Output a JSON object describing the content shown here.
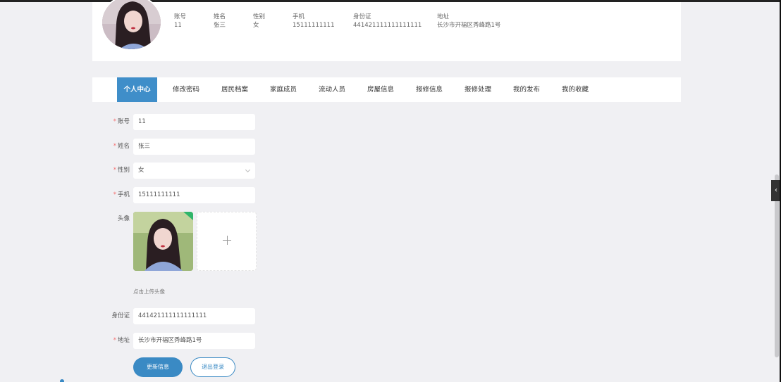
{
  "profile": {
    "fields": [
      {
        "label": "账号",
        "value": "11"
      },
      {
        "label": "姓名",
        "value": "张三"
      },
      {
        "label": "性别",
        "value": "女"
      },
      {
        "label": "手机",
        "value": "15111111111"
      },
      {
        "label": "身份证",
        "value": "441421111111111111"
      },
      {
        "label": "地址",
        "value": "长沙市开福区秀峰路1号"
      }
    ]
  },
  "nav": {
    "items": [
      "个人中心",
      "修改密码",
      "居民档案",
      "家庭成员",
      "流动人员",
      "房屋信息",
      "报修信息",
      "报修处理",
      "我的发布",
      "我的收藏"
    ],
    "active": "个人中心"
  },
  "form": {
    "account": {
      "label": "账号",
      "value": "11"
    },
    "name": {
      "label": "姓名",
      "value": "张三"
    },
    "gender": {
      "label": "性别",
      "value": "女"
    },
    "phone": {
      "label": "手机",
      "value": "15111111111"
    },
    "avatar": {
      "label": "头像",
      "hint": "点击上传头像"
    },
    "idcard": {
      "label": "身份证",
      "value": "441421111111111111"
    },
    "address": {
      "label": "地址",
      "value": "长沙市开福区秀峰路1号"
    }
  },
  "buttons": {
    "update": "更新信息",
    "logout": "退出登录"
  },
  "side_tab": "‹",
  "colors": {
    "primary": "#3a8ac4",
    "required": "#f56c6c",
    "success": "#2fb56a"
  }
}
